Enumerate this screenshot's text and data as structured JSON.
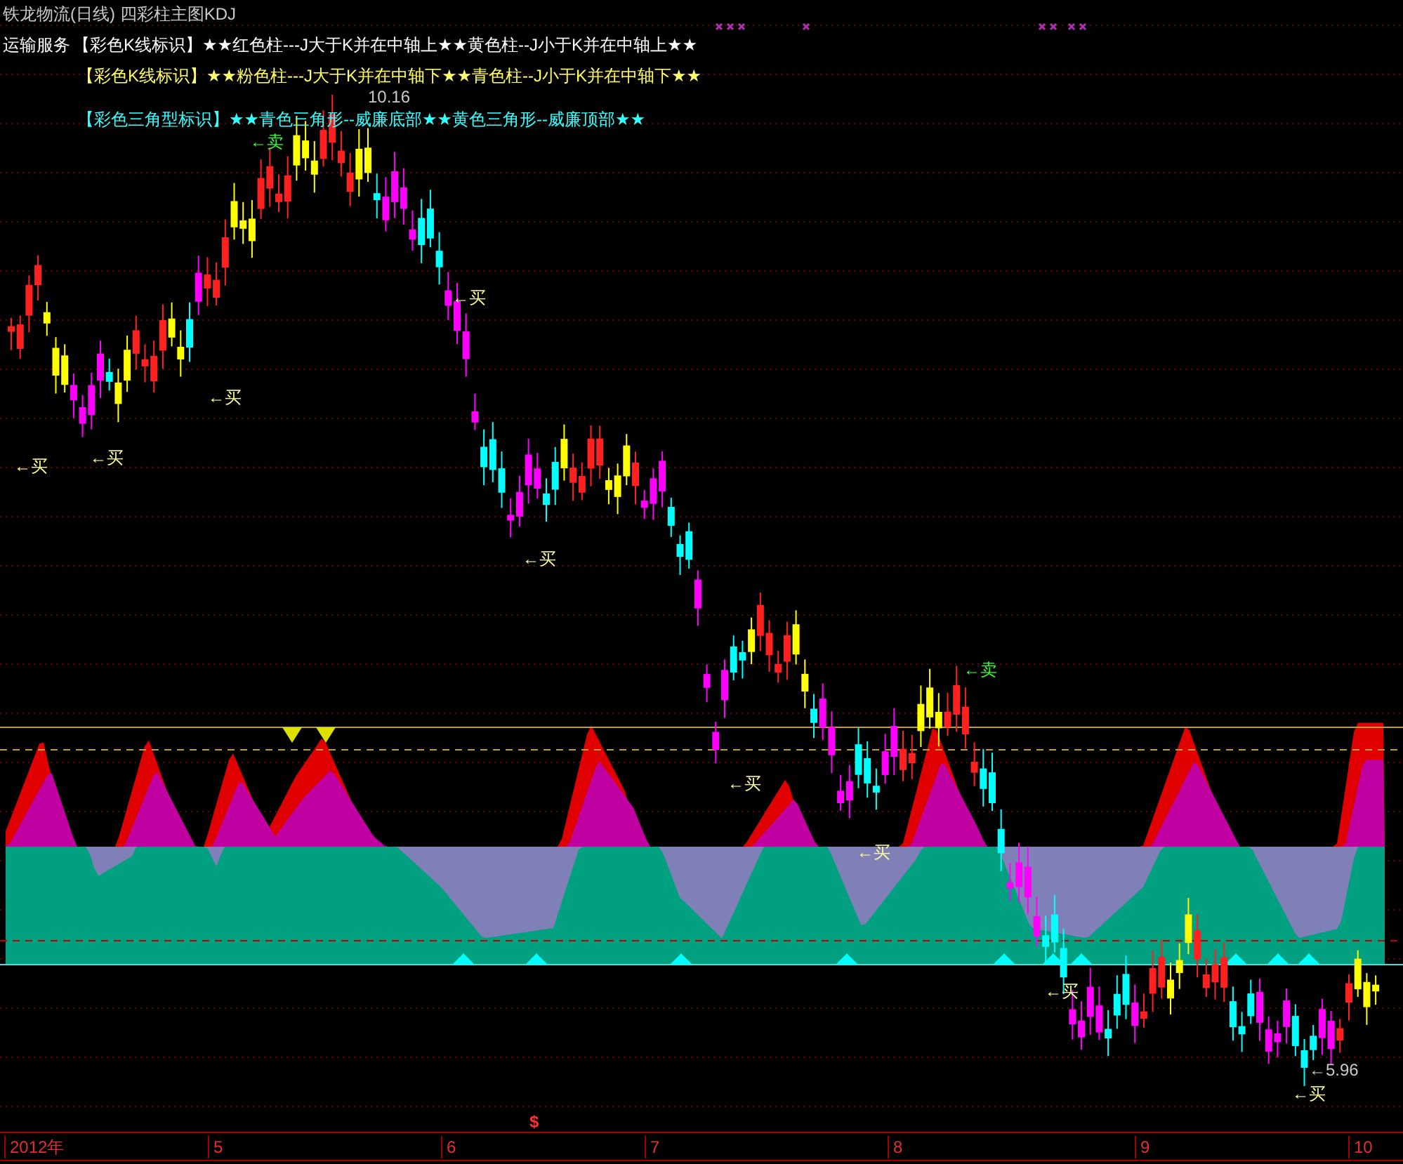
{
  "window": {
    "title": "铁龙物流(日线) 四彩柱主图KDJ"
  },
  "sector": "运输服务",
  "legend": [
    {
      "text": "【彩色K线标识】★★红色柱---J大于K并在中轴上★★黄色柱--J小于K并在中轴上★★",
      "color": "#ffffff"
    },
    {
      "text": "【彩色K线标识】★★粉色柱---J大于K并在中轴下★★青色柱--J小于K并在中轴下★★",
      "color": "#ffff66"
    },
    {
      "text": "【彩色三角型标识】★★青色三角形--威廉底部★★黄色三角形--威廉顶部★★",
      "color": "#33ffff"
    }
  ],
  "signals": [
    {
      "text": "←卖",
      "kind": "sell"
    },
    {
      "text": "←买",
      "kind": "buy"
    },
    {
      "text": "←买",
      "kind": "buy"
    },
    {
      "text": "←买",
      "kind": "buy"
    },
    {
      "text": "←买",
      "kind": "buy"
    },
    {
      "text": "←买",
      "kind": "buy"
    },
    {
      "text": "←卖",
      "kind": "sell"
    },
    {
      "text": "←买",
      "kind": "buy"
    },
    {
      "text": "←买",
      "kind": "buy"
    },
    {
      "text": "←买",
      "kind": "buy"
    },
    {
      "text": "←买",
      "kind": "buy"
    }
  ],
  "price_labels": [
    {
      "text": "10.16"
    },
    {
      "text": "←5.96"
    }
  ],
  "axis": {
    "marker": "$",
    "labels": [
      "2012年",
      "5",
      "6",
      "7",
      "8",
      "9",
      "10"
    ]
  }
}
